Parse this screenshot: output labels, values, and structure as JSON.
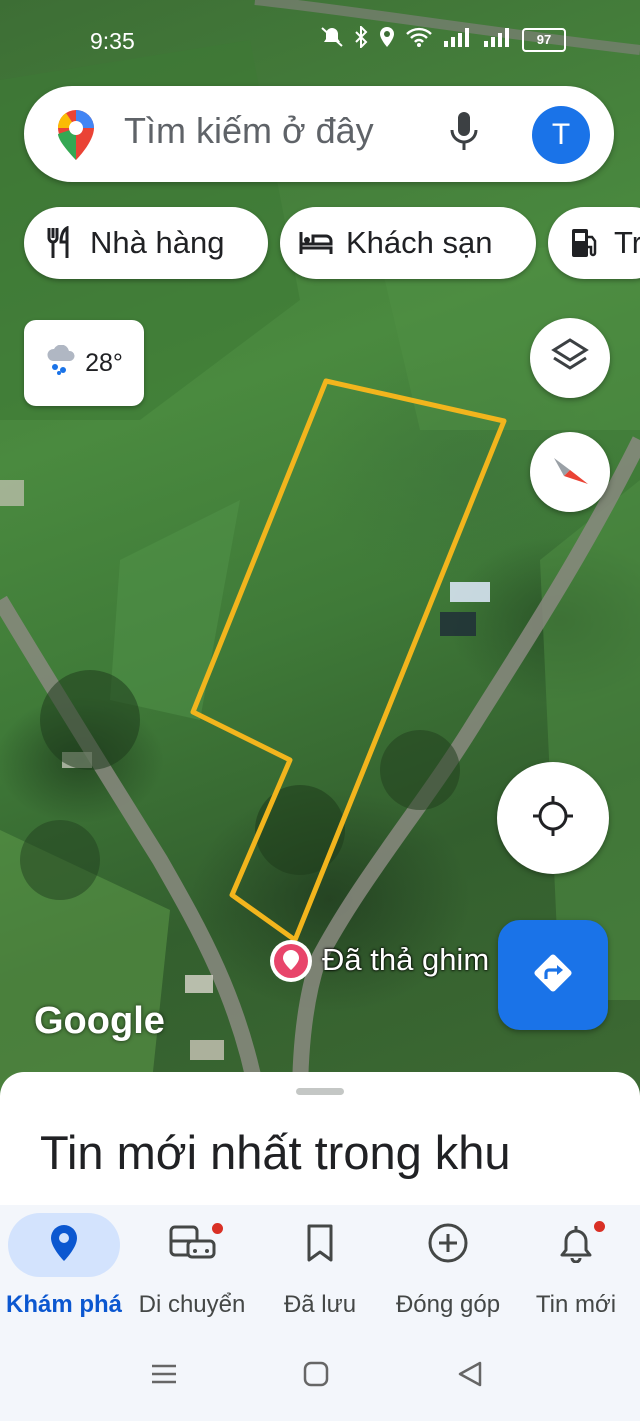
{
  "status_bar": {
    "time": "9:35",
    "battery": "97"
  },
  "search": {
    "placeholder": "Tìm kiếm ở đây",
    "avatar_letter": "T"
  },
  "chips": [
    {
      "label": "Nhà hàng",
      "icon": "restaurant-icon"
    },
    {
      "label": "Khách sạn",
      "icon": "hotel-icon"
    },
    {
      "label": "Tr",
      "icon": "gas-station-icon"
    }
  ],
  "weather": {
    "temperature": "28°",
    "icon": "rain-cloud-icon"
  },
  "map": {
    "pin_label": "Đã thả ghim",
    "watermark": "Google",
    "boundary_color": "#f2b51d"
  },
  "sheet": {
    "title": "Tin mới nhất trong khu vực"
  },
  "nav": {
    "items": [
      {
        "label": "Khám phá",
        "icon": "explore-pin-icon",
        "active": true
      },
      {
        "label": "Di chuyển",
        "icon": "commute-icon",
        "badge": true
      },
      {
        "label": "Đã lưu",
        "icon": "bookmark-icon"
      },
      {
        "label": "Đóng góp",
        "icon": "add-circle-icon"
      },
      {
        "label": "Tin mới",
        "icon": "bell-icon",
        "badge": true
      }
    ]
  },
  "colors": {
    "accent": "#1a73e8",
    "active_nav_bg": "#d3e3fd",
    "badge": "#d93025"
  }
}
